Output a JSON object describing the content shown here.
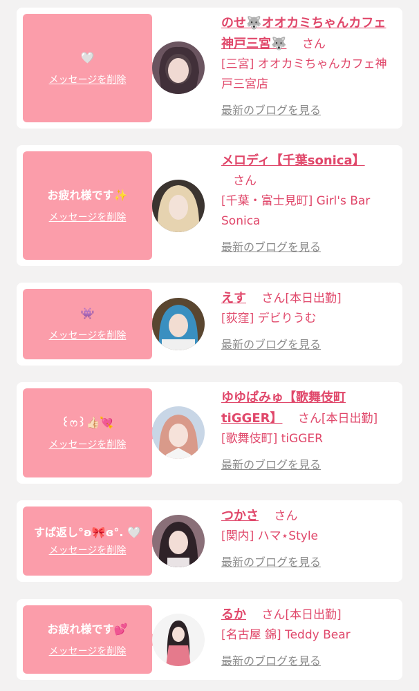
{
  "delete_label": "メッセージを削除",
  "blog_label": "最新のブログを見る",
  "colors": {
    "accent": "#e0476a",
    "bubble": "#fb9daa",
    "link_gray": "#8b8b8b",
    "background": "#f3f2f2"
  },
  "cards": [
    {
      "message": "🤍",
      "name": "のせ🐺オオカミちゃんカフェ神戸三宮🐺",
      "san": "さん",
      "shop": "[三宮] オオカミちゃんカフェ神戸三宮店"
    },
    {
      "message": "お疲れ様です✨",
      "name": "メロディ【千葉sonica】",
      "san": "さん",
      "shop": "[千葉・富士見町] Girl's Bar Sonica"
    },
    {
      "message": "👾",
      "name": "えす",
      "san": "さん[本日出勤]",
      "shop": "[荻窪] デビりうむ"
    },
    {
      "message": "꒰ෆ꒱👍🏻💘",
      "name": "ゆゆぱみゅ【歌舞伎町tiGGER】",
      "san": "さん[本日出勤]",
      "shop": "[歌舞伎町] tiGGER"
    },
    {
      "message": "すぱ返し°ʚ🎀ɞ°. 🤍",
      "name": "つかさ",
      "san": "さん",
      "shop": "[関内] ハマ⋆Style"
    },
    {
      "message": "お疲れ様です💕",
      "name": "るか",
      "san": "さん[本日出勤]",
      "shop": "[名古屋 錦] Teddy Bear"
    }
  ]
}
